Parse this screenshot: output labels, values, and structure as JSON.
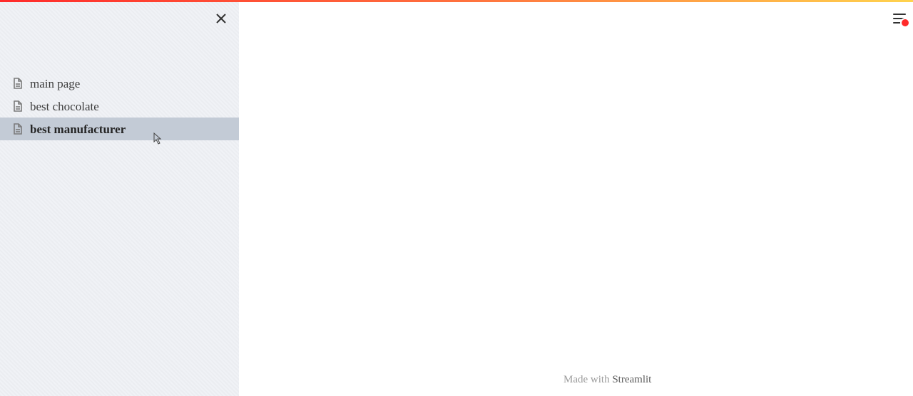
{
  "sidebar": {
    "items": [
      {
        "label": "main page",
        "slug": "main-page",
        "selected": false
      },
      {
        "label": "best chocolate",
        "slug": "best-chocolate",
        "selected": false
      },
      {
        "label": "best manufacturer",
        "slug": "best-manufacturer",
        "selected": true
      }
    ]
  },
  "footer": {
    "made_with": "Made with ",
    "brand": "Streamlit"
  },
  "status": {
    "running": true
  }
}
